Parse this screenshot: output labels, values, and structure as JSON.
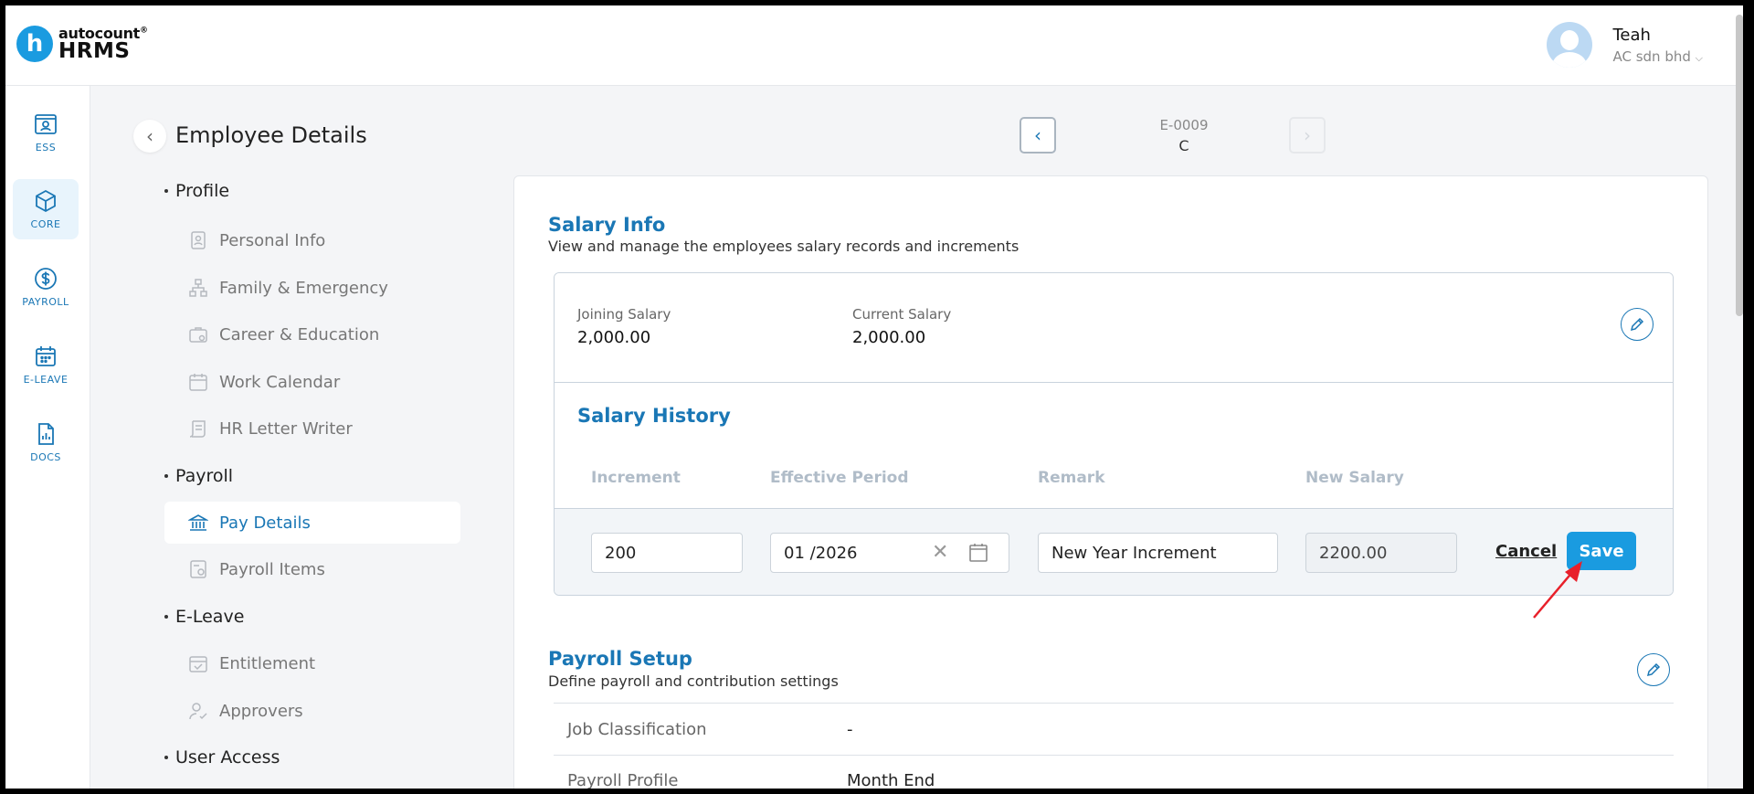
{
  "app": {
    "logo_letter": "h",
    "logo_small": "autocount",
    "logo_reg": "®",
    "logo_big": "HRMS"
  },
  "user": {
    "name": "Teah",
    "company": "AC sdn bhd"
  },
  "rail": [
    {
      "label": "ESS",
      "icon": "ess-id-card-icon"
    },
    {
      "label": "CORE",
      "icon": "cube-icon"
    },
    {
      "label": "PAYROLL",
      "icon": "dollar-icon"
    },
    {
      "label": "E-LEAVE",
      "icon": "calendar-icon"
    },
    {
      "label": "DOCS",
      "icon": "document-chart-icon"
    }
  ],
  "page": {
    "title": "Employee Details",
    "emp_code": "E-0009",
    "emp_name": "C"
  },
  "sections": {
    "profile": {
      "label": "Profile",
      "items": [
        "Personal Info",
        "Family & Emergency",
        "Career & Education",
        "Work Calendar",
        "HR Letter Writer"
      ]
    },
    "payroll": {
      "label": "Payroll",
      "items": [
        "Pay Details",
        "Payroll Items"
      ]
    },
    "eleave": {
      "label": "E-Leave",
      "items": [
        "Entitlement",
        "Approvers"
      ]
    },
    "access": {
      "label": "User Access"
    }
  },
  "salary_info": {
    "title": "Salary Info",
    "subtitle": "View and manage the employees salary records and increments",
    "joining_label": "Joining Salary",
    "joining_value": "2,000.00",
    "current_label": "Current Salary",
    "current_value": "2,000.00"
  },
  "salary_history": {
    "title": "Salary History",
    "columns": [
      "Increment",
      "Effective Period",
      "Remark",
      "New Salary"
    ],
    "edit_row": {
      "increment": "200",
      "period": "01 /2026",
      "remark": "New Year Increment",
      "new_salary": "2200.00"
    },
    "cancel_label": "Cancel",
    "save_label": "Save"
  },
  "payroll_setup": {
    "title": "Payroll Setup",
    "subtitle": "Define payroll and contribution settings",
    "rows": [
      {
        "label": "Job Classification",
        "value": "-"
      },
      {
        "label": "Payroll Profile",
        "value": "Month End"
      }
    ]
  },
  "colors": {
    "accent": "#1a77b5",
    "button": "#1a9be0",
    "annotation_arrow": "#e8202a"
  }
}
